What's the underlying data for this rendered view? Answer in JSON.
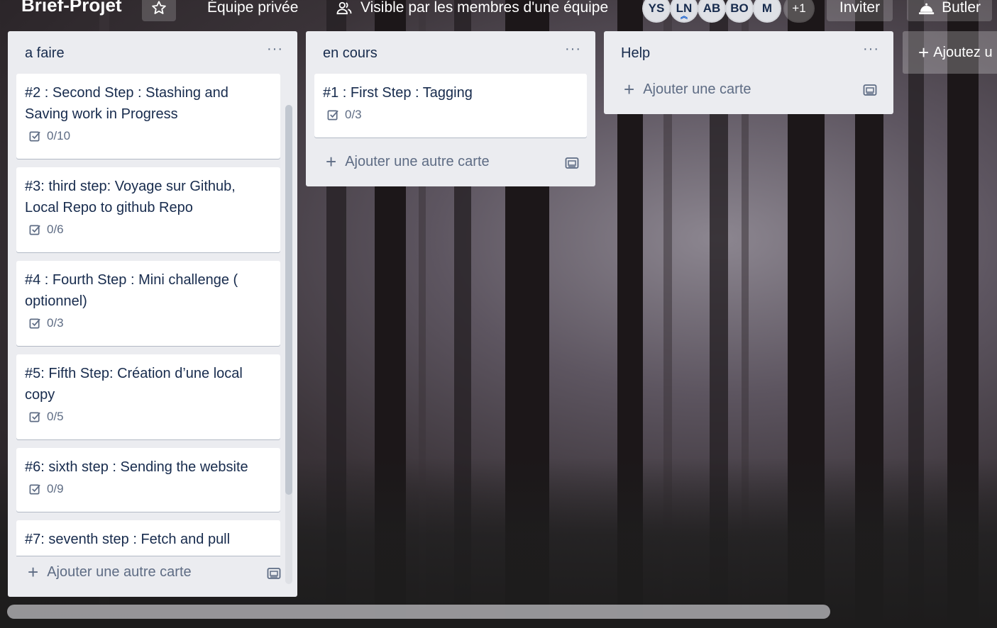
{
  "header": {
    "board_title": "Brief-Projet",
    "team": "Équipe privée",
    "visibility": "Visible par les membres d'une équipe",
    "members": [
      "YS",
      "LN",
      "AB",
      "BO",
      "M"
    ],
    "members_more": "+1",
    "invite_label": "Inviter",
    "butler_label": "Butler"
  },
  "lists": [
    {
      "title": "a faire",
      "menu": "···",
      "cards": [
        {
          "title": "#2 : Second Step : Stashing and Saving work in Progress",
          "checklist": "0/10"
        },
        {
          "title": "#3: third step: Voyage sur Github, Local Repo to github Repo",
          "checklist": "0/6"
        },
        {
          "title": "#4 : Fourth Step : Mini challenge ( optionnel)",
          "checklist": "0/3"
        },
        {
          "title": "#5: Fifth Step: Création d’une local copy",
          "checklist": "0/5"
        },
        {
          "title": "#6: sixth step : Sending the website",
          "checklist": "0/9"
        },
        {
          "title": "#7: seventh step : Fetch and pull"
        }
      ],
      "add_card": "Ajouter une autre carte"
    },
    {
      "title": "en cours",
      "menu": "···",
      "cards": [
        {
          "title": "#1 : First Step : Tagging",
          "checklist": "0/3"
        }
      ],
      "add_card": "Ajouter une autre carte"
    },
    {
      "title": "Help",
      "menu": "···",
      "cards": [],
      "add_card": "Ajouter une carte"
    }
  ],
  "add_list": "Ajoutez u",
  "icons": {
    "star": "star-icon",
    "visibility": "team-visibility-icon",
    "butler": "butler-bell-icon",
    "checklist": "checkbox-icon",
    "template": "card-template-icon"
  },
  "colors": {
    "list_bg": "#ebecf0",
    "card_bg": "#ffffff",
    "text": "#172b4d",
    "muted": "#5e6c84"
  }
}
